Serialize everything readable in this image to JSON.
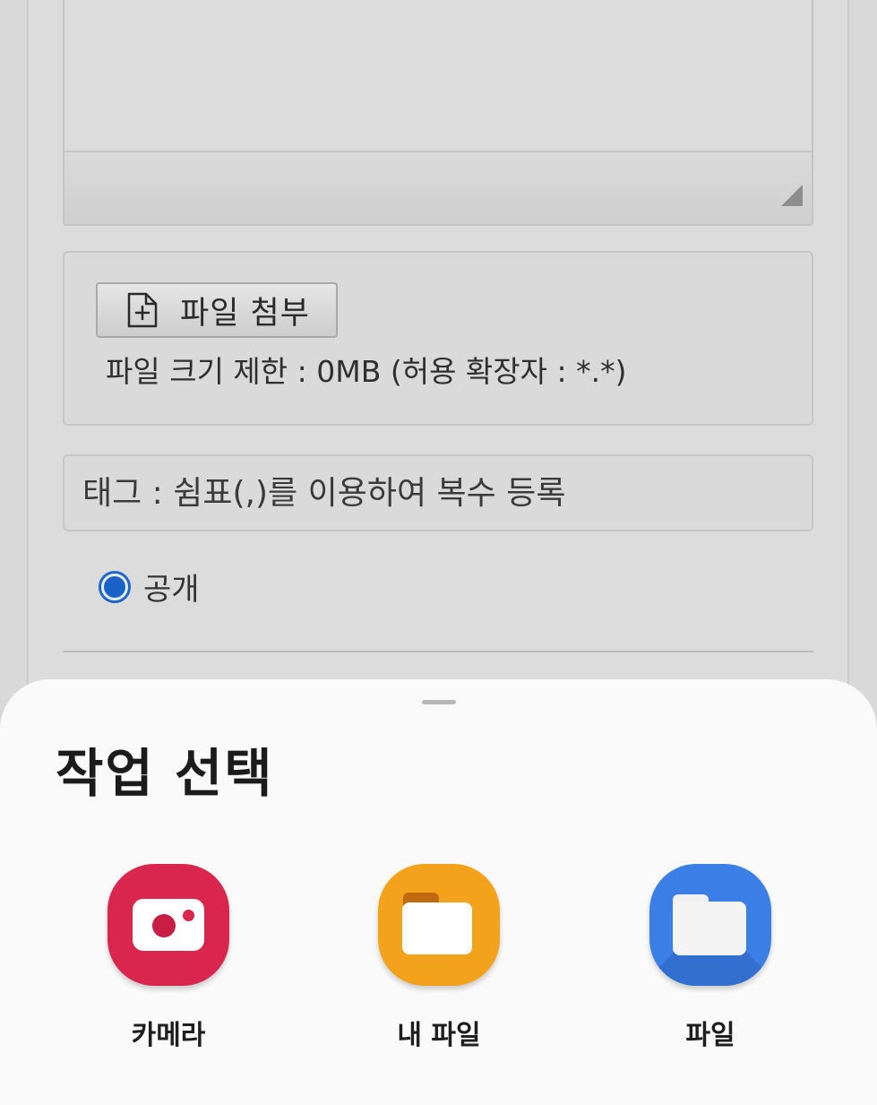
{
  "page": {
    "attach": {
      "button_label": "파일 첨부",
      "limit_text": "파일 크기 제한 : 0MB (허용 확장자 : *.*)"
    },
    "tag": {
      "placeholder": "태그 : 쉼표(,)를 이용하여 복수 등록"
    },
    "visibility": {
      "selected_label": "공개"
    }
  },
  "sheet": {
    "title": "작업 선택",
    "options": [
      {
        "label": "카메라",
        "icon": "camera-app-icon",
        "color": "#d8264e"
      },
      {
        "label": "내 파일",
        "icon": "my-files-app-icon",
        "color": "#f2a21b"
      },
      {
        "label": "파일",
        "icon": "files-app-icon",
        "color": "#3b7fe6"
      }
    ]
  },
  "colors": {
    "radio_accent": "#1a62c8",
    "sheet_background": "#fafafa",
    "overlay_background": "#d9d9d9"
  }
}
